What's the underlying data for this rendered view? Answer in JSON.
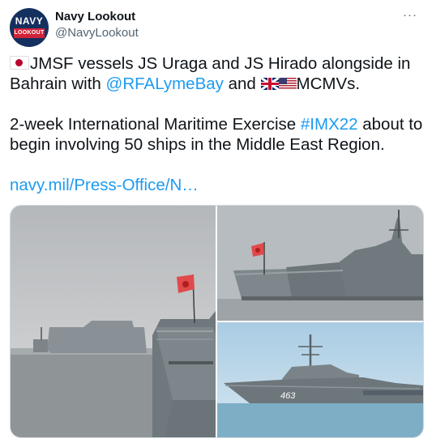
{
  "account": {
    "display_name": "Navy Lookout",
    "handle": "@NavyLookout",
    "avatar_text_top": "NAVY",
    "avatar_text_bottom": "LOOKOUT",
    "avatar_color": "#14305e",
    "avatar_accent": "#d0233a"
  },
  "menu": {
    "more_icon": "more-horizontal-icon",
    "more_label": "···"
  },
  "tweet": {
    "line1_text": "JMSF vessels JS Uraga and JS Hirado alongside in Bahrain with ",
    "mention": "@RFALymeBay",
    "line1_after_mention": " and ",
    "line1_end": "MCMVs.",
    "line2_text": "2-week International Maritime Exercise ",
    "hashtag": "#IMX22",
    "line2_after_hashtag": " about to begin involving 50 ships in the Middle East Region.",
    "link": "navy.mil/Press-Office/N…",
    "flags": [
      "japan-flag-icon",
      "uk-flag-icon",
      "us-flag-icon"
    ]
  },
  "media": {
    "images": [
      {
        "name": "ships-alongside-pier-with-rising-sun-flag"
      },
      {
        "name": "grey-ships-moored-at-quay"
      },
      {
        "name": "warship-bow-hull-number"
      }
    ],
    "hull_number": "463"
  },
  "colors": {
    "link": "#1d9bf0",
    "text": "#0f1419",
    "secondary": "#536471",
    "border": "#cfd9de"
  }
}
